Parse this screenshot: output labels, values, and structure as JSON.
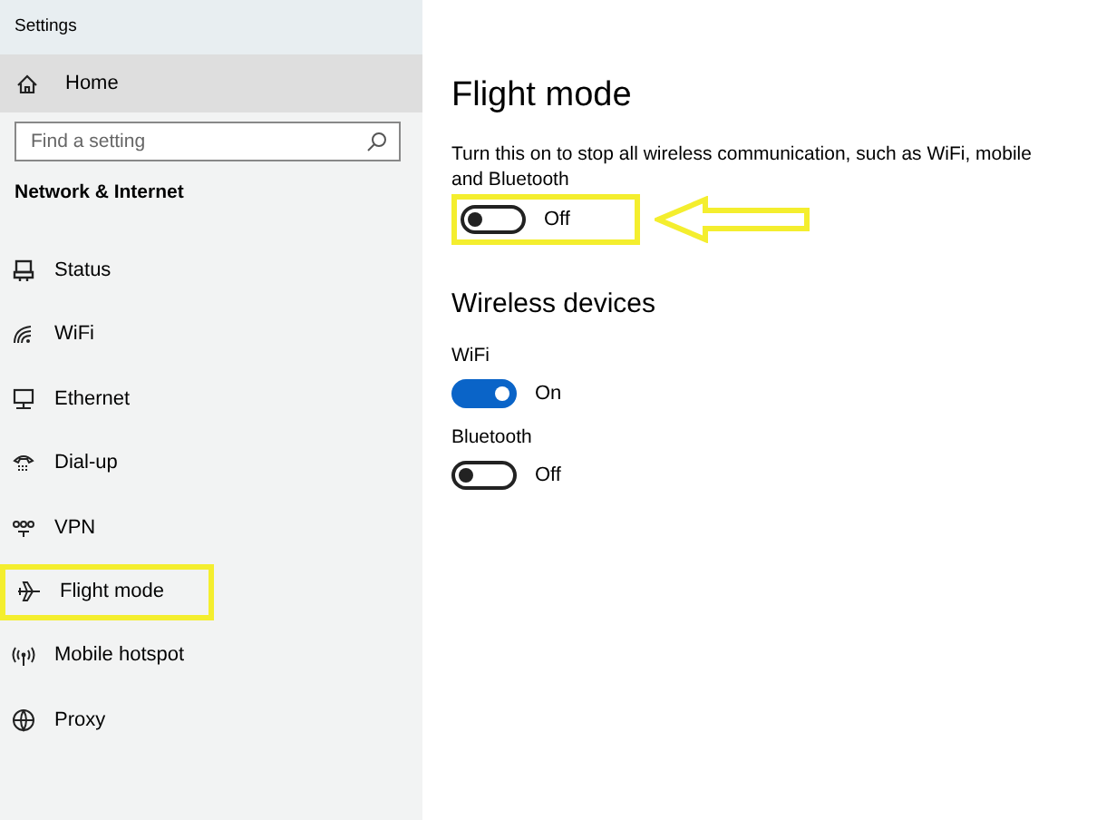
{
  "window": {
    "title": "Settings"
  },
  "sidebar": {
    "home": "Home",
    "search": {
      "placeholder": "Find a setting"
    },
    "section": "Network & Internet",
    "items": [
      {
        "kind": "status",
        "label": "Status",
        "highlighted": false
      },
      {
        "kind": "wifi",
        "label": "WiFi",
        "highlighted": false
      },
      {
        "kind": "ethernet",
        "label": "Ethernet",
        "highlighted": false
      },
      {
        "kind": "dialup",
        "label": "Dial-up",
        "highlighted": false
      },
      {
        "kind": "vpn",
        "label": "VPN",
        "highlighted": false
      },
      {
        "kind": "flight",
        "label": "Flight mode",
        "highlighted": true
      },
      {
        "kind": "hotspot",
        "label": "Mobile hotspot",
        "highlighted": false
      },
      {
        "kind": "proxy",
        "label": "Proxy",
        "highlighted": false
      }
    ]
  },
  "main": {
    "title": "Flight mode",
    "description": "Turn this on to stop all wireless communication, such as WiFi, mobile and Bluetooth",
    "toggle": {
      "on": false,
      "state_label": "Off",
      "highlighted": true
    },
    "wireless_title": "Wireless devices",
    "devices": [
      {
        "label": "WiFi",
        "on": true,
        "state_label": "On"
      },
      {
        "label": "Bluetooth",
        "on": false,
        "state_label": "Off"
      }
    ]
  }
}
